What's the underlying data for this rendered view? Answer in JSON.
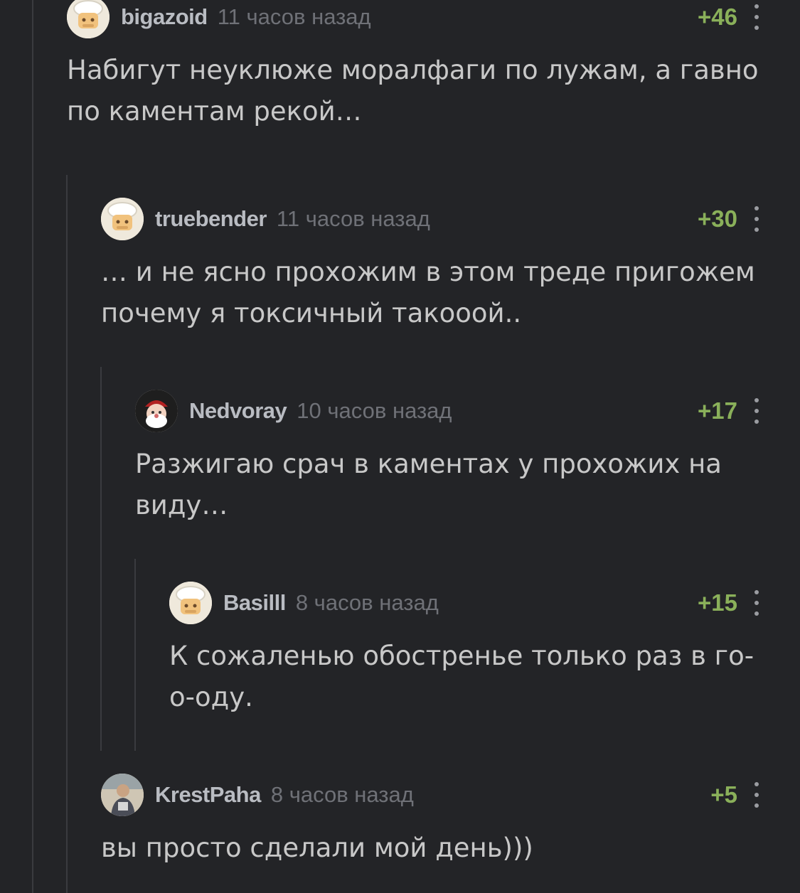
{
  "comments": [
    {
      "user": "bigazoid",
      "time": "11 часов назад",
      "rating": "+46",
      "text": "Набигут неуклюже моралфаги по лужам, а гавно по каментам рекой…",
      "avatar": "chef-avatar"
    },
    {
      "user": "truebender",
      "time": "11 часов назад",
      "rating": "+30",
      "text": "… и не ясно прохожим в этом треде пригожем почему я токсичный такооой..",
      "avatar": "chef-avatar"
    },
    {
      "user": "Nedvoray",
      "time": "10 часов назад",
      "rating": "+17",
      "text": "Разжигаю срач в каментах у прохожих на виду…",
      "avatar": "santa-avatar"
    },
    {
      "user": "Basilll",
      "time": "8 часов назад",
      "rating": "+15",
      "text": "К сожаленью обостренье только раз в го-о-оду.",
      "avatar": "chef-avatar"
    },
    {
      "user": "KrestPaha",
      "time": "8 часов назад",
      "rating": "+5",
      "text": "вы просто сделали мой день)))",
      "avatar": "photo-avatar"
    }
  ],
  "colors": {
    "background": "#232427",
    "rating": "#8ab05a",
    "username": "#b9bcc2",
    "time": "#6f7177",
    "text": "#c8c8c8",
    "thread_line": "#3a3b3f"
  }
}
